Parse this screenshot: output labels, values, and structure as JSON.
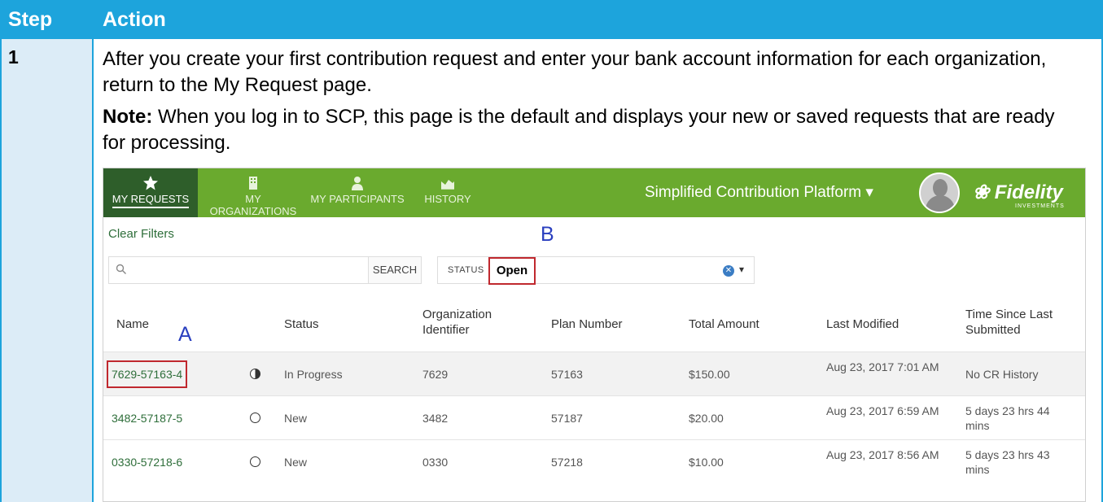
{
  "header": {
    "step_label": "Step",
    "action_label": "Action"
  },
  "step": {
    "number": "1"
  },
  "instructions": {
    "paragraph1": "After you create your first contribution request and enter your bank account information for each organization, return to the My Request page.",
    "note_label": "Note:",
    "note_text": " When you log in to SCP, this page is the default and displays your new or saved requests that are ready for processing."
  },
  "app": {
    "nav": [
      {
        "label": "MY REQUESTS",
        "icon": "star-icon",
        "active": true
      },
      {
        "label": "MY ORGANIZATIONS",
        "icon": "building-icon",
        "active": false
      },
      {
        "label": "MY PARTICIPANTS",
        "icon": "person-icon",
        "active": false
      },
      {
        "label": "HISTORY",
        "icon": "chart-icon",
        "active": false
      }
    ],
    "title": "Simplified Contribution Platform",
    "brand": "Fidelity",
    "brand_sub": "INVESTMENTS",
    "clear_filters": "Clear Filters",
    "search": {
      "placeholder": "",
      "button": "SEARCH"
    },
    "status_filter": {
      "label": "STATUS",
      "value": "Open"
    },
    "annotations": {
      "a": "A",
      "b": "B"
    },
    "columns": [
      "Name",
      "Status",
      "Organization Identifier",
      "Plan Number",
      "Total Amount",
      "Last Modified",
      "Time Since Last Submitted"
    ],
    "rows": [
      {
        "name": "7629-57163-4",
        "status": "In Progress",
        "status_icon": "half-circle-icon",
        "org_id": "7629",
        "plan": "57163",
        "amount": "$150.00",
        "modified": "Aug 23, 2017 7:01 AM",
        "since": "No CR History"
      },
      {
        "name": "3482-57187-5",
        "status": "New",
        "status_icon": "empty-circle-icon",
        "org_id": "3482",
        "plan": "57187",
        "amount": "$20.00",
        "modified": "Aug 23, 2017 6:59 AM",
        "since": "5 days 23 hrs 44 mins"
      },
      {
        "name": "0330-57218-6",
        "status": "New",
        "status_icon": "empty-circle-icon",
        "org_id": "0330",
        "plan": "57218",
        "amount": "$10.00",
        "modified": "Aug 23, 2017 8:56 AM",
        "since": "5 days 23 hrs 43 mins"
      }
    ]
  },
  "colors": {
    "header_blue": "#1da4dc",
    "nav_green": "#6aaa2e",
    "nav_active": "#2e5e2a",
    "highlight_red": "#c0282e",
    "annotation_blue": "#2a3fbf"
  }
}
